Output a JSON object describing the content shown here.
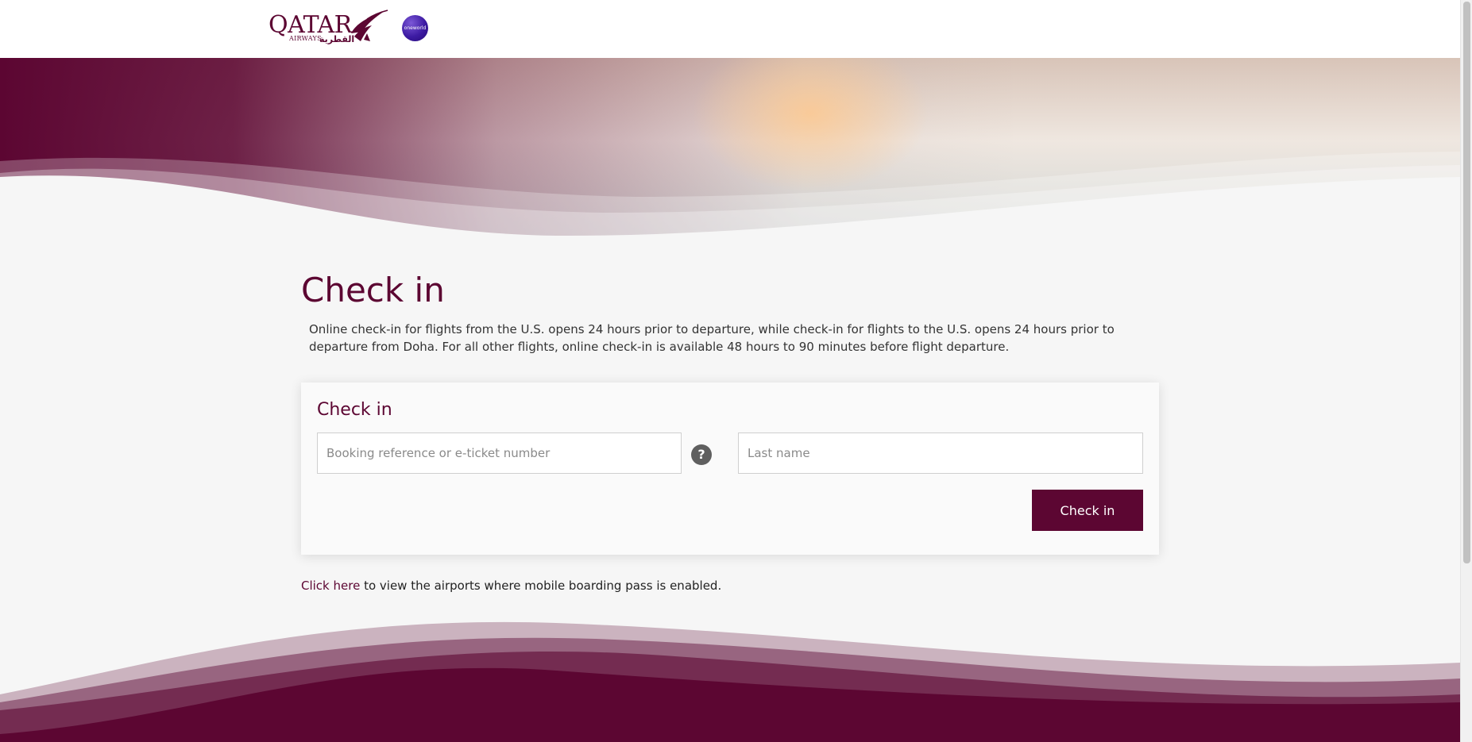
{
  "brand": {
    "logo_text": "QATAR",
    "logo_sub": "AIRWAYS",
    "logo_arabic": "القطرية",
    "alliance_badge": "oneworld",
    "primary_color": "#5c0632"
  },
  "page": {
    "title": "Check in",
    "intro": "Online check-in for flights from the U.S. opens 24 hours prior to departure, while check-in for flights to the U.S. opens 24 hours prior to departure from Doha. For all other flights, online check-in is available 48 hours to 90 minutes before flight departure."
  },
  "form": {
    "title": "Check in",
    "booking_placeholder": "Booking reference or e-ticket number",
    "booking_value": "",
    "help_icon": "?",
    "lastname_placeholder": "Last name",
    "lastname_value": "",
    "submit_label": "Check in"
  },
  "footnote": {
    "link_text": "Click here",
    "rest_text": " to view the airports where mobile boarding pass is enabled."
  }
}
